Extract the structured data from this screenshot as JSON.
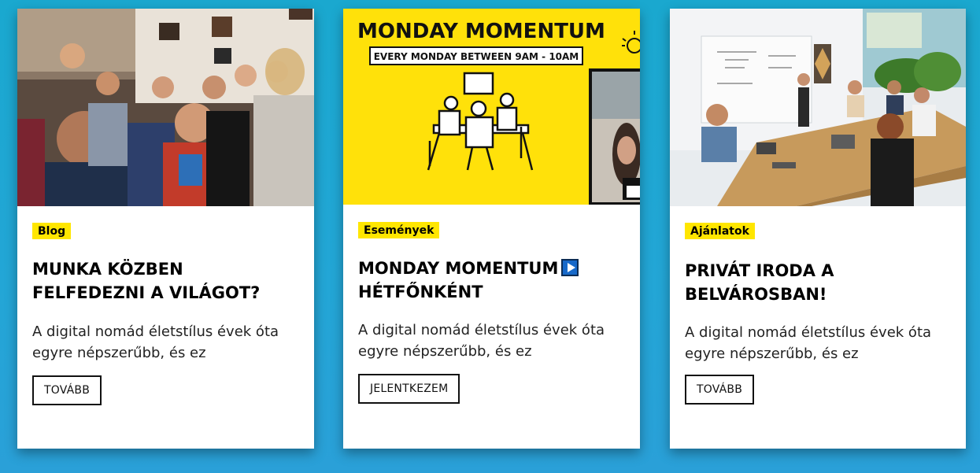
{
  "cards": [
    {
      "category": "Blog",
      "title": "MUNKA KÖZBEN FELFEDEZNI A VILÁGOT?",
      "excerpt": "A digital nomád életstílus évek óta egyre népszerűbb, és ez",
      "button_label": "TOVÁBB",
      "image": {
        "subject": "party-crowd-photo"
      }
    },
    {
      "category": "Események",
      "title": "MONDAY MOMENTUM",
      "title_line2": "HÉTFŐNKÉNT",
      "title_icon": "play-icon",
      "excerpt": "A digital nomád életstílus évek óta egyre népszerűbb, és ez",
      "button_label": "JELENTKEZEM",
      "image": {
        "subject": "monday-momentum-banner",
        "headline": "MONDAY MOMENTUM",
        "subhead": "EVERY MONDAY BETWEEN  9AM - 10AM",
        "background": "#ffe10a"
      }
    },
    {
      "category": "Ajánlatok",
      "title": "PRIVÁT IRODA A BELVÁROSBAN!",
      "excerpt": "A digital nomád életstílus évek óta egyre népszerűbb, és ez",
      "button_label": "TOVÁBB",
      "image": {
        "subject": "office-meeting-photo"
      }
    }
  ],
  "colors": {
    "tag_background": "#ffe600",
    "page_background": "#23a6d6",
    "play_icon": "#1769c9"
  }
}
